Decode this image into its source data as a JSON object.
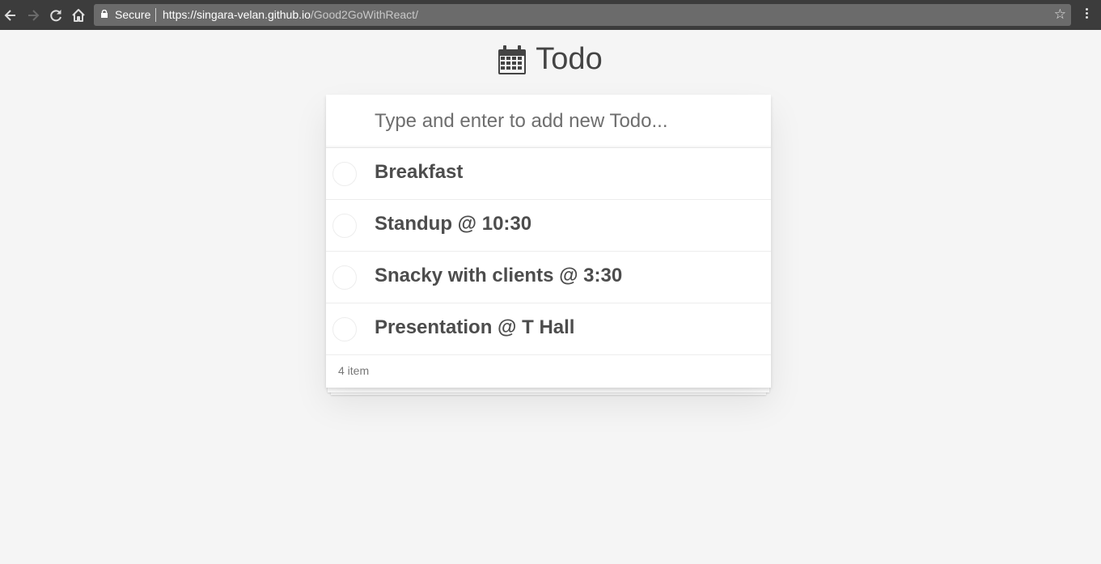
{
  "browser": {
    "back_icon": "arrow-left-icon",
    "forward_icon": "arrow-right-icon",
    "reload_icon": "reload-icon",
    "home_icon": "home-icon",
    "secure_label": "Secure",
    "url_host": "https://singara-velan.github.io",
    "url_path": "/Good2GoWithReact/",
    "bookmark_icon": "star-icon",
    "menu_icon": "more-vert-icon"
  },
  "app": {
    "title_icon": "calendar-icon",
    "title": "Todo",
    "new_todo_placeholder": "Type and enter to add new Todo...",
    "new_todo_value": "",
    "todos": [
      {
        "label": "Breakfast",
        "completed": false
      },
      {
        "label": "Standup @ 10:30",
        "completed": false
      },
      {
        "label": "Snacky with clients @ 3:30",
        "completed": false
      },
      {
        "label": "Presentation @ T Hall",
        "completed": false
      }
    ],
    "footer_count": "4 item"
  },
  "colors": {
    "chrome_bg": "#3c3c3c",
    "omnibox_bg": "#6b6b6b",
    "page_bg": "#f5f5f5",
    "text": "#4d4d4d"
  }
}
